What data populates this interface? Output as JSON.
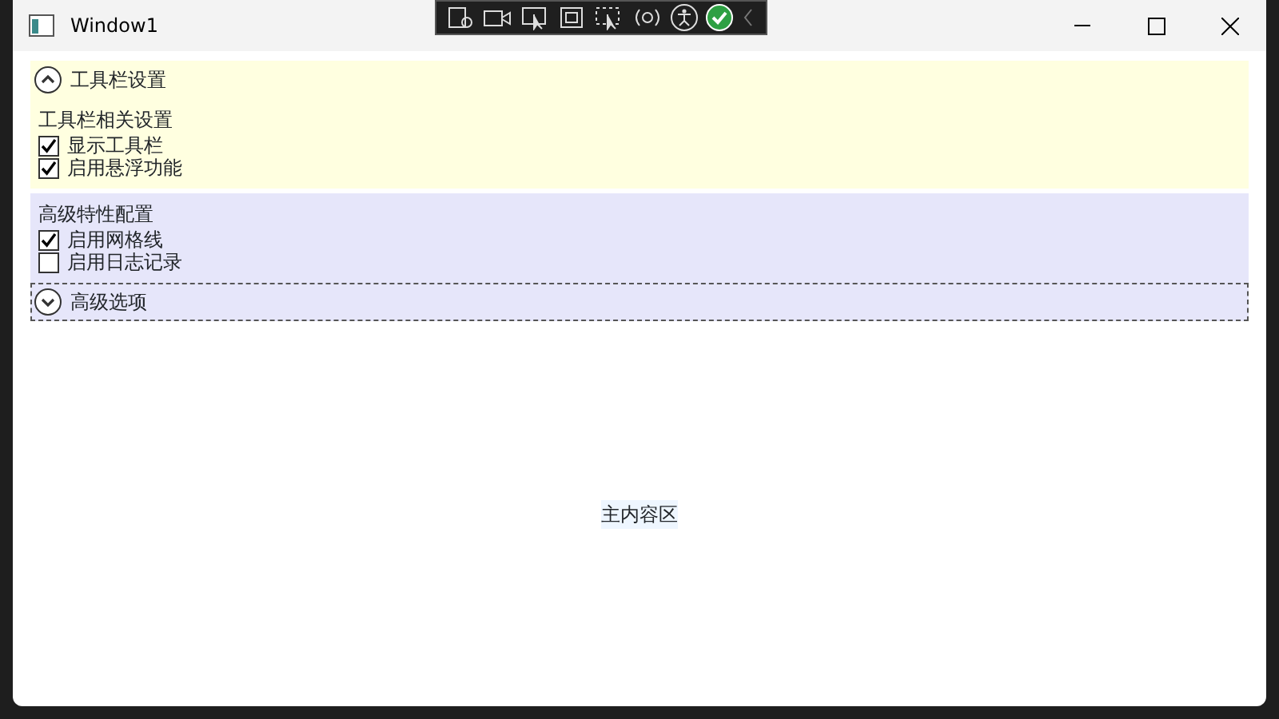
{
  "window": {
    "title": "Window1"
  },
  "expanders": [
    {
      "header": "工具栏设置",
      "expanded": true,
      "kind": "down",
      "focused": false,
      "color": "#ffffe0",
      "group_label": "工具栏相关设置",
      "options": [
        {
          "label": "显示工具栏",
          "checked": true
        },
        {
          "label": "启用悬浮功能",
          "checked": true
        }
      ]
    },
    {
      "header": "高级选项",
      "expanded": true,
      "kind": "up",
      "focused": true,
      "color": "#e6e6fa",
      "group_label": "高级特性配置",
      "options": [
        {
          "label": "启用网格线",
          "checked": true
        },
        {
          "label": "启用日志记录",
          "checked": false
        }
      ]
    }
  ],
  "main_content": {
    "text": "主内容区"
  }
}
